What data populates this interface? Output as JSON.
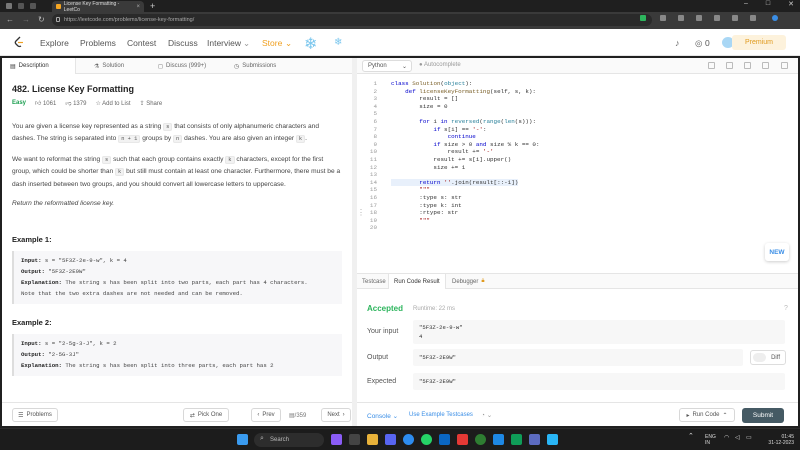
{
  "browser": {
    "tab_title": "License Key Formatting - LeetCo",
    "url": "https://leetcode.com/problems/license-key-formatting/"
  },
  "nav": {
    "links": [
      "Explore",
      "Problems",
      "Contest",
      "Discuss",
      "Interview",
      "Store"
    ],
    "coins": "0",
    "premium": "Premium"
  },
  "left_tabs": [
    "Description",
    "Solution",
    "Discuss (999+)",
    "Submissions"
  ],
  "problem": {
    "title": "482. License Key Formatting",
    "difficulty": "Easy",
    "likes": "1061",
    "dislikes": "1379",
    "add_to_list": "Add to List",
    "share": "Share",
    "p1a": "You are given a license key represented as a string ",
    "p1_s": "s",
    "p1b": " that consists of only alphanumeric characters and dashes. The string is separated into ",
    "p1_n1": "n + 1",
    "p1c": " groups by ",
    "p1_n": "n",
    "p1d": " dashes. You are also given an integer ",
    "p1_k": "k",
    "p1e": ".",
    "p2a": "We want to reformat the string ",
    "p2_s": "s",
    "p2b": " such that each group contains exactly ",
    "p2_k": "k",
    "p2c": " characters, except for the first group, which could be shorter than ",
    "p2_k2": "k",
    "p2d": " but still must contain at least one character. Furthermore, there must be a dash inserted between two groups, and you should convert all lowercase letters to uppercase.",
    "p3": "Return the reformatted license key.",
    "examples": [
      {
        "heading": "Example 1:",
        "input": "s = \"5F3Z-2e-9-w\", k = 4",
        "output": "\"5F3Z-2E9W\"",
        "explanation": "The string s has been split into two parts, each part has 4 characters.",
        "note": "Note that the two extra dashes are not needed and can be removed."
      },
      {
        "heading": "Example 2:",
        "input": "s = \"2-5g-3-J\", k = 2",
        "output": "\"2-5G-3J\"",
        "explanation": "The string s has been split into three parts, each part has 2"
      }
    ],
    "labels": {
      "input": "Input:",
      "output": "Output:",
      "explanation": "Explanation:"
    }
  },
  "left_bottom": {
    "problems": "Problems",
    "pick_one": "Pick One",
    "prev": "Prev",
    "page": "/359",
    "next": "Next"
  },
  "editor": {
    "language": "Python",
    "autocomplete": "Autocomplete",
    "lines": [
      "class Solution(object):",
      "    def licenseKeyFormatting(self, s, k):",
      "        result = []",
      "        size = 0",
      "",
      "        for i in reversed(range(len(s))):",
      "            if s[i] == '-':",
      "                continue",
      "            if size > 0 and size % k == 0:",
      "                result += '-'",
      "            result += s[i].upper()",
      "            size += 1",
      "",
      "        return ''.join(result[::-1])",
      "        \"\"\"",
      "        :type s: str",
      "        :type k: int",
      "        :rtype: str",
      "        \"\"\"",
      ""
    ],
    "new_badge": "NEW"
  },
  "result": {
    "tabs": [
      "Testcase",
      "Run Code Result",
      "Debugger"
    ],
    "status": "Accepted",
    "runtime": "Runtime: 22 ms",
    "your_input_label": "Your input",
    "your_input": [
      "\"5F3Z-2e-9-w\"",
      "4"
    ],
    "output_label": "Output",
    "output": "\"5F3Z-2E9W\"",
    "diff": "Diff",
    "expected_label": "Expected",
    "expected": "\"5F3Z-2E9W\""
  },
  "right_bottom": {
    "console": "Console",
    "use_example": "Use Example Testcases",
    "run_code": "Run Code",
    "submit": "Submit"
  },
  "taskbar": {
    "search": "Search",
    "lang1": "ENG",
    "lang2": "IN",
    "time": "01:45",
    "date": "31-12-2023"
  }
}
